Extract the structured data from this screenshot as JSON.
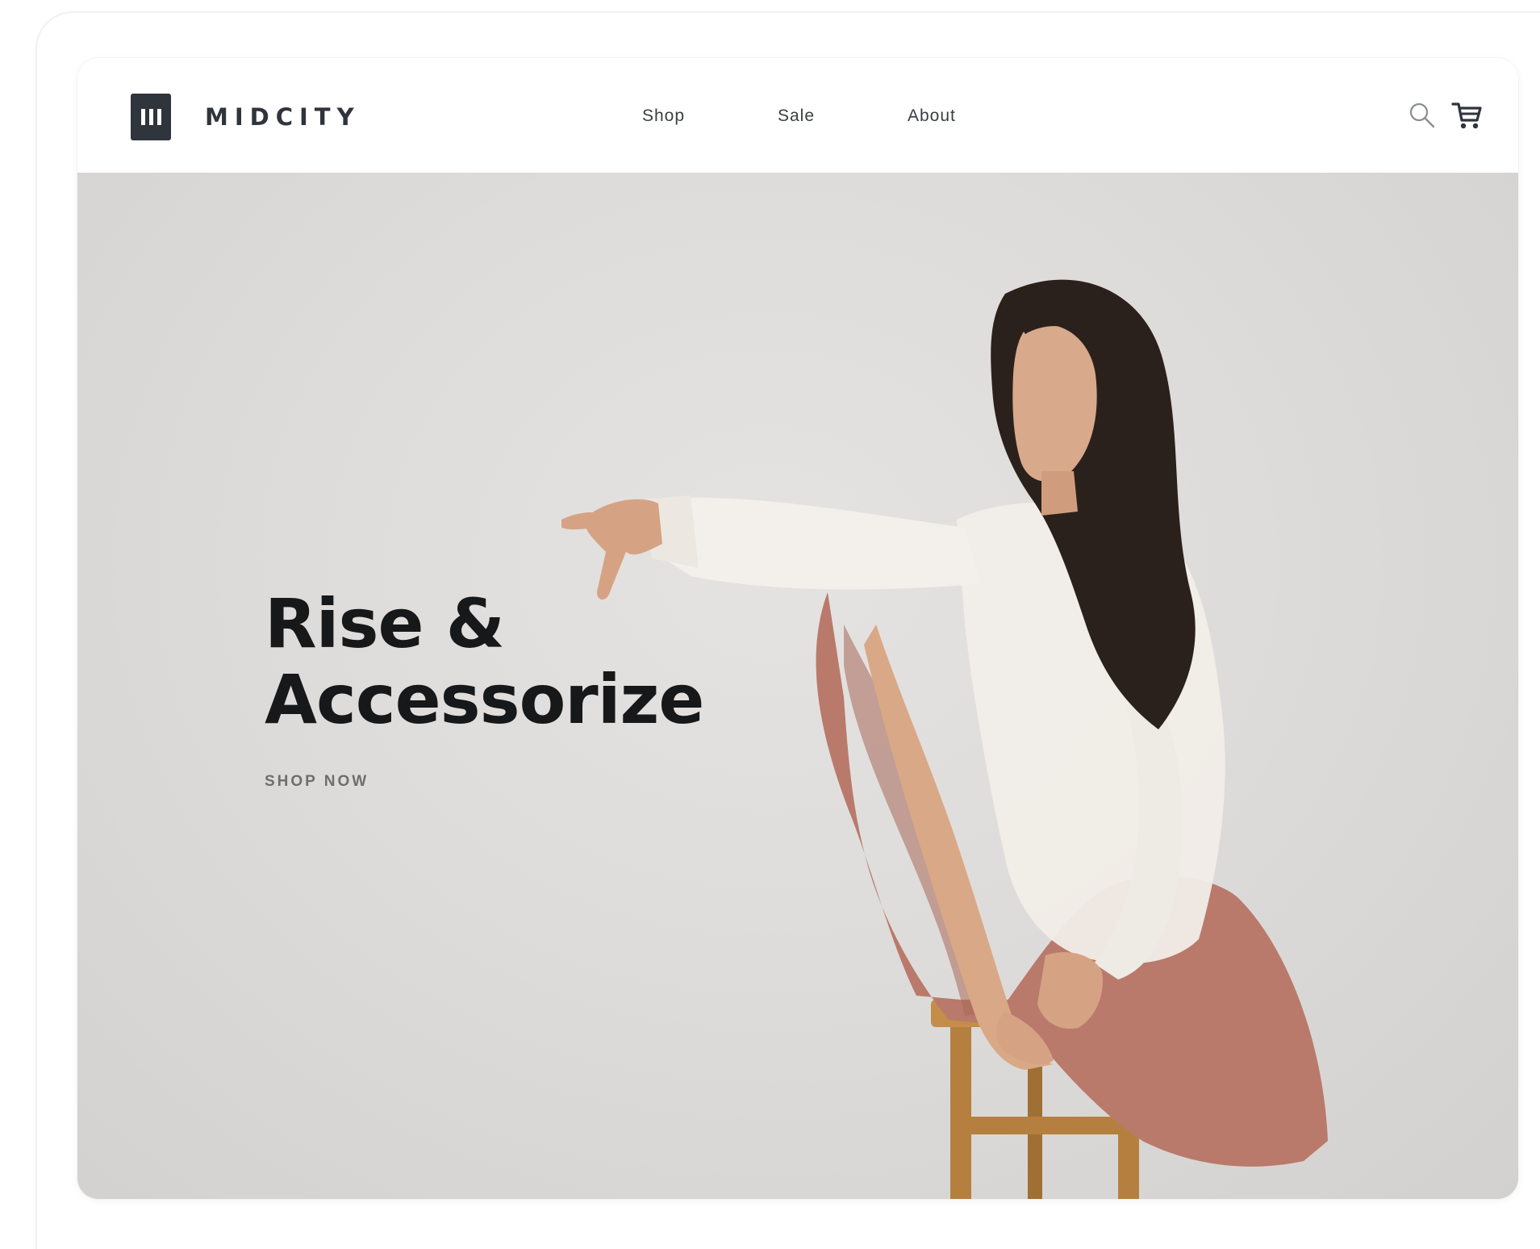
{
  "brand": {
    "name": "MIDCITY",
    "logo_icon": "midcity-logo-icon"
  },
  "nav": {
    "links": [
      {
        "label": "Shop"
      },
      {
        "label": "Sale"
      },
      {
        "label": "About"
      }
    ],
    "icons": [
      "search-icon",
      "cart-icon"
    ]
  },
  "hero": {
    "title_line1": "Rise &",
    "title_line2": "Accessorize",
    "cta_label": "SHOP NOW",
    "image": "woman-sitting-on-stool-photo"
  },
  "colors": {
    "brand_dark": "#2f343d",
    "hero_bg": "#dedcda",
    "headline": "#17181a",
    "pants": "#b97a6b",
    "stool": "#b5803f"
  }
}
